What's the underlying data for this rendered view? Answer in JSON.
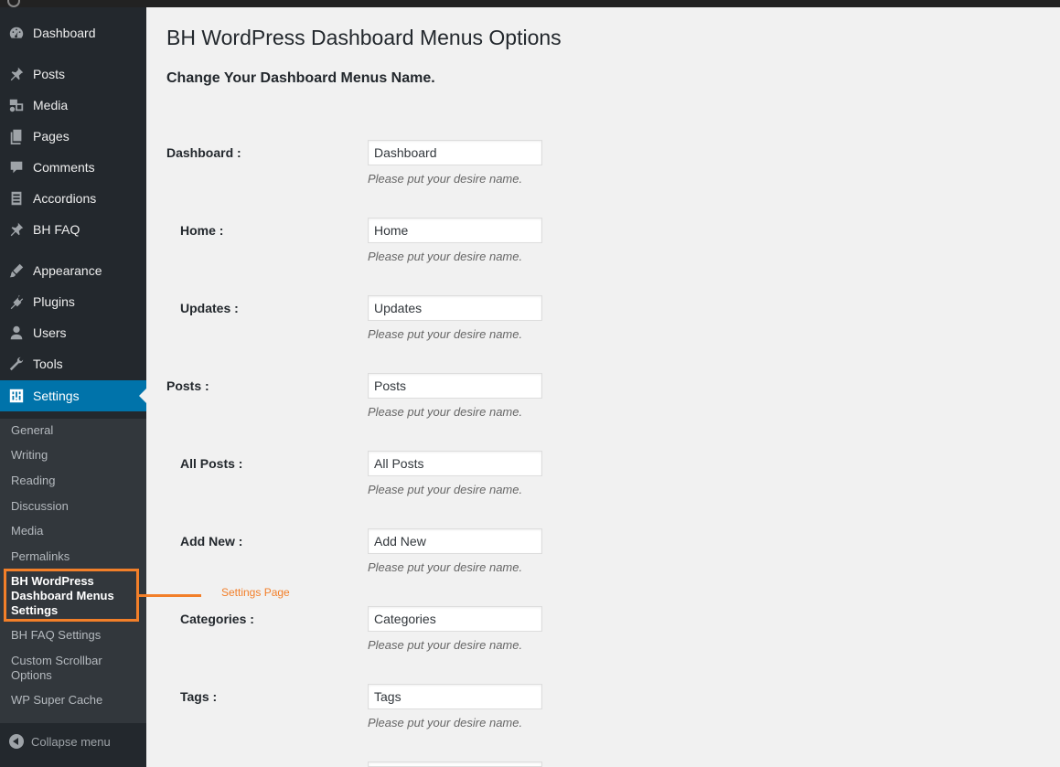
{
  "sidebar": {
    "menu": [
      {
        "label": "Dashboard",
        "icon": "dashboard-icon"
      },
      {
        "label": "Posts",
        "icon": "pin-icon"
      },
      {
        "label": "Media",
        "icon": "media-icon"
      },
      {
        "label": "Pages",
        "icon": "pages-icon"
      },
      {
        "label": "Comments",
        "icon": "comment-icon"
      },
      {
        "label": "Accordions",
        "icon": "table-icon"
      },
      {
        "label": "BH FAQ",
        "icon": "pin-icon"
      },
      {
        "label": "Appearance",
        "icon": "brush-icon"
      },
      {
        "label": "Plugins",
        "icon": "plugin-icon"
      },
      {
        "label": "Users",
        "icon": "user-icon"
      },
      {
        "label": "Tools",
        "icon": "wrench-icon"
      },
      {
        "label": "Settings",
        "icon": "settings-icon"
      }
    ],
    "submenu": [
      "General",
      "Writing",
      "Reading",
      "Discussion",
      "Media",
      "Permalinks",
      "BH WordPress Dashboard Menus Settings",
      "BH FAQ Settings",
      "Custom Scrollbar Options",
      "WP Super Cache"
    ],
    "collapse_label": "Collapse menu"
  },
  "annotation": {
    "text": "Settings Page",
    "color": "#f27f29"
  },
  "main": {
    "title": "BH WordPress Dashboard Menus Options",
    "subtitle": "Change Your Dashboard Menus Name.",
    "fields": [
      {
        "label": "Dashboard :",
        "value": "Dashboard",
        "hint": "Please put your desire name."
      },
      {
        "label": "Home :",
        "value": "Home",
        "hint": "Please put your desire name."
      },
      {
        "label": "Updates :",
        "value": "Updates",
        "hint": "Please put your desire name."
      },
      {
        "label": "Posts :",
        "value": "Posts",
        "hint": "Please put your desire name."
      },
      {
        "label": "All Posts :",
        "value": "All Posts",
        "hint": "Please put your desire name."
      },
      {
        "label": "Add New :",
        "value": "Add New",
        "hint": "Please put your desire name."
      },
      {
        "label": "Categories :",
        "value": "Categories",
        "hint": "Please put your desire name."
      },
      {
        "label": "Tags :",
        "value": "Tags",
        "hint": "Please put your desire name."
      }
    ]
  },
  "colors": {
    "sidebar_bg": "#23282d",
    "submenu_bg": "#32373c",
    "active_bg": "#0073aa",
    "highlight": "#f27f29"
  }
}
